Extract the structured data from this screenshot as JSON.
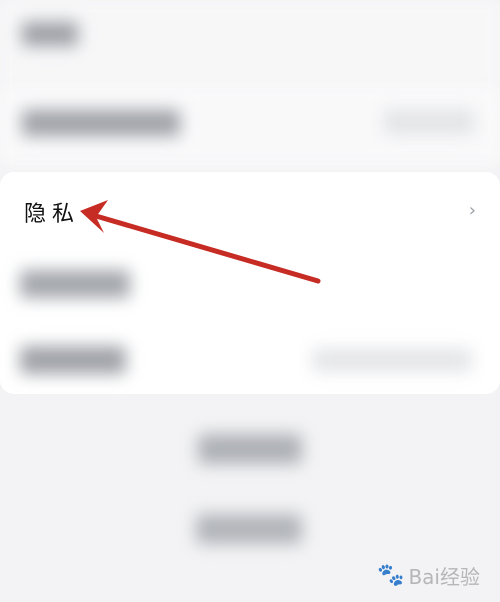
{
  "privacy": {
    "label": "隐私",
    "chevron": "›"
  },
  "watermark": {
    "text": "Bai经验"
  },
  "icons": {
    "chevron": "chevron-right-icon",
    "arrow": "red-arrow-annotation",
    "paw": "baidu-paw-icon"
  },
  "colors": {
    "arrow": "#c62b24",
    "background": "#f3f3f5",
    "card": "#ffffff"
  }
}
